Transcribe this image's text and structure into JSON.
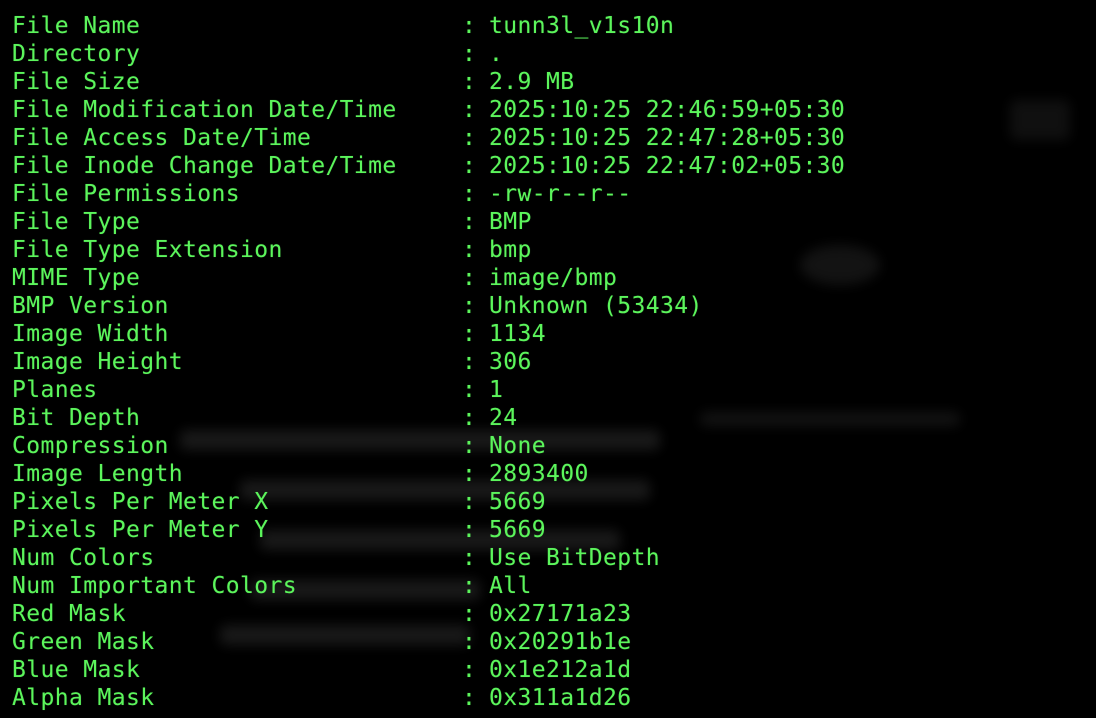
{
  "terminal": {
    "text_color": "#5cf55c",
    "background_color": "#000000",
    "separator": ":",
    "rows": [
      {
        "label": "File Name",
        "value": "tunn3l_v1s10n"
      },
      {
        "label": "Directory",
        "value": "."
      },
      {
        "label": "File Size",
        "value": "2.9 MB"
      },
      {
        "label": "File Modification Date/Time",
        "value": "2025:10:25 22:46:59+05:30"
      },
      {
        "label": "File Access Date/Time",
        "value": "2025:10:25 22:47:28+05:30"
      },
      {
        "label": "File Inode Change Date/Time",
        "value": "2025:10:25 22:47:02+05:30"
      },
      {
        "label": "File Permissions",
        "value": "-rw-r--r--"
      },
      {
        "label": "File Type",
        "value": "BMP"
      },
      {
        "label": "File Type Extension",
        "value": "bmp"
      },
      {
        "label": "MIME Type",
        "value": "image/bmp"
      },
      {
        "label": "BMP Version",
        "value": "Unknown (53434)"
      },
      {
        "label": "Image Width",
        "value": "1134"
      },
      {
        "label": "Image Height",
        "value": "306"
      },
      {
        "label": "Planes",
        "value": "1"
      },
      {
        "label": "Bit Depth",
        "value": "24"
      },
      {
        "label": "Compression",
        "value": "None"
      },
      {
        "label": "Image Length",
        "value": "2893400"
      },
      {
        "label": "Pixels Per Meter X",
        "value": "5669"
      },
      {
        "label": "Pixels Per Meter Y",
        "value": "5669"
      },
      {
        "label": "Num Colors",
        "value": "Use BitDepth"
      },
      {
        "label": "Num Important Colors",
        "value": "All"
      },
      {
        "label": "Red Mask",
        "value": "0x27171a23"
      },
      {
        "label": "Green Mask",
        "value": "0x20291b1e"
      },
      {
        "label": "Blue Mask",
        "value": "0x1e212a1d"
      },
      {
        "label": "Alpha Mask",
        "value": "0x311a1d26"
      }
    ]
  }
}
